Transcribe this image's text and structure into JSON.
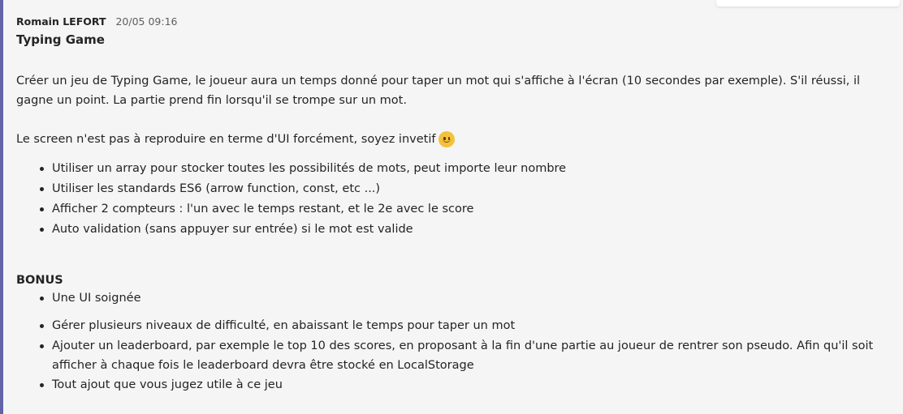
{
  "message": {
    "author": "Romain LEFORT",
    "timestamp": "20/05 09:16",
    "subject": "Typing Game",
    "intro": "Créer un jeu de Typing Game, le joueur aura un temps donné pour taper un mot qui s'affiche à l'écran (10 secondes par exemple). S'il réussi, il gagne un point. La partie prend fin lorsqu'il se trompe sur un mot.",
    "note": "Le screen n'est pas à reproduire en terme d'UI forcément, soyez invetif",
    "emoji_icon": "slightly-smiling-face-icon",
    "requirements": [
      "Utiliser un array pour stocker toutes les possibilités de mots, peut importe leur nombre",
      "Utiliser les standards ES6  (arrow function, const, etc ...)",
      "Afficher 2 compteurs : l'un avec le temps restant, et le 2e avec le score",
      "Auto validation (sans appuyer sur entrée) si le mot est valide"
    ],
    "bonus_title": "BONUS",
    "bonus_first": [
      "Une UI soignée"
    ],
    "bonus_rest": [
      "Gérer plusieurs niveaux de difficulté, en abaissant le temps pour taper un mot",
      "Ajouter un leaderboard, par exemple le top 10 des scores, en proposant à la fin d'une partie au joueur de rentrer son pseudo. Afin qu'il soit afficher à chaque fois le leaderboard devra être stocké en LocalStorage",
      "Tout ajout que vous jugez utile à ce jeu"
    ]
  },
  "colors": {
    "accent_bar": "#6264a7",
    "background": "#f5f5f5",
    "text": "#252423",
    "timestamp": "#605e5c"
  }
}
